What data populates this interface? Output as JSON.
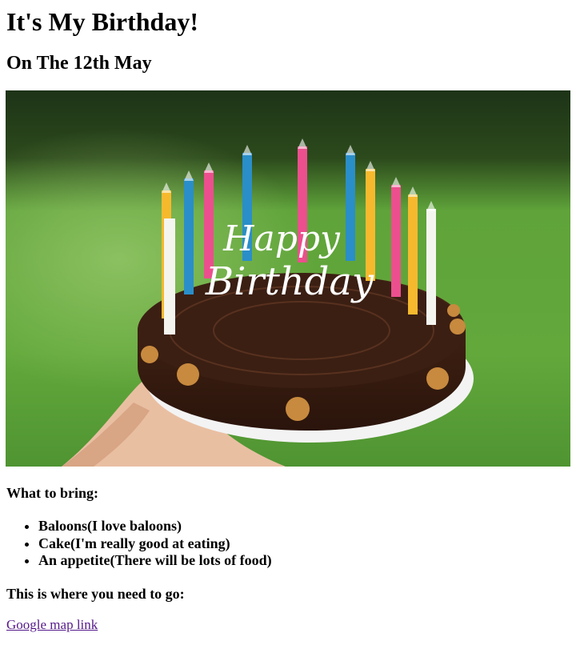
{
  "page": {
    "heading": "It's My Birthday!",
    "subheading": "On The 12th May",
    "image": {
      "text_line1": "Happy",
      "text_line2": "Birthday",
      "colors": {
        "background_green": "#5fa33a",
        "cake_chocolate": "#3a1e12",
        "plate": "#f3f3f3",
        "candle_blue": "#2a8ec9",
        "candle_pink": "#ec4f8d",
        "candle_yellow": "#f6b92e",
        "candle_white": "#f5f5f0"
      }
    },
    "bring_label": "What to bring:",
    "items": [
      "Baloons(I love baloons)",
      "Cake(I'm really good at eating)",
      "An appetite(There will be lots of food)"
    ],
    "directions_label": "This is where you need to go:",
    "map_link_text": "Google map link",
    "link_color": "#551a8b"
  }
}
